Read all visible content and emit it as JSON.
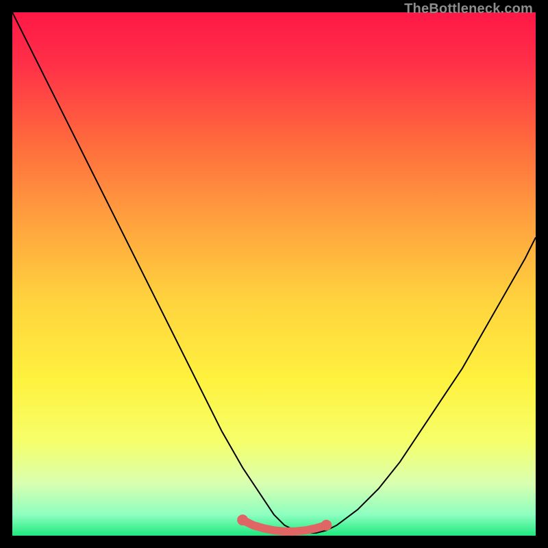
{
  "watermark": "TheBottleneck.com",
  "chart_data": {
    "type": "line",
    "title": "",
    "xlabel": "",
    "ylabel": "",
    "xlim": [
      0,
      100
    ],
    "ylim": [
      0,
      100
    ],
    "grid": false,
    "series": [
      {
        "name": "curve",
        "color": "#000000",
        "x": [
          0,
          4,
          8,
          12,
          16,
          20,
          24,
          28,
          32,
          36,
          40,
          44,
          48,
          50,
          52,
          54,
          56,
          58,
          60,
          62,
          66,
          70,
          74,
          78,
          82,
          86,
          90,
          94,
          98,
          100
        ],
        "y": [
          100,
          92,
          84,
          76,
          68,
          60,
          52,
          44,
          36,
          28,
          20,
          13,
          7,
          4,
          2,
          1,
          0.5,
          0.5,
          1,
          2,
          5,
          9,
          14,
          20,
          26,
          32,
          39,
          46,
          53,
          57
        ]
      },
      {
        "name": "highlight",
        "color": "#e06666",
        "x": [
          44,
          46,
          48,
          50,
          52,
          54,
          56,
          58,
          60
        ],
        "y": [
          3.0,
          2.0,
          1.4,
          1.0,
          0.8,
          0.8,
          1.0,
          1.4,
          2.0
        ]
      }
    ],
    "background_gradient": {
      "stops": [
        {
          "offset": 0.0,
          "color": "#ff1846"
        },
        {
          "offset": 0.1,
          "color": "#ff3048"
        },
        {
          "offset": 0.25,
          "color": "#ff6b3d"
        },
        {
          "offset": 0.4,
          "color": "#ffa23e"
        },
        {
          "offset": 0.55,
          "color": "#ffd33e"
        },
        {
          "offset": 0.7,
          "color": "#fff13e"
        },
        {
          "offset": 0.82,
          "color": "#f6ff6a"
        },
        {
          "offset": 0.9,
          "color": "#d9ffb0"
        },
        {
          "offset": 0.96,
          "color": "#8dffc0"
        },
        {
          "offset": 1.0,
          "color": "#1fe87d"
        }
      ]
    }
  }
}
